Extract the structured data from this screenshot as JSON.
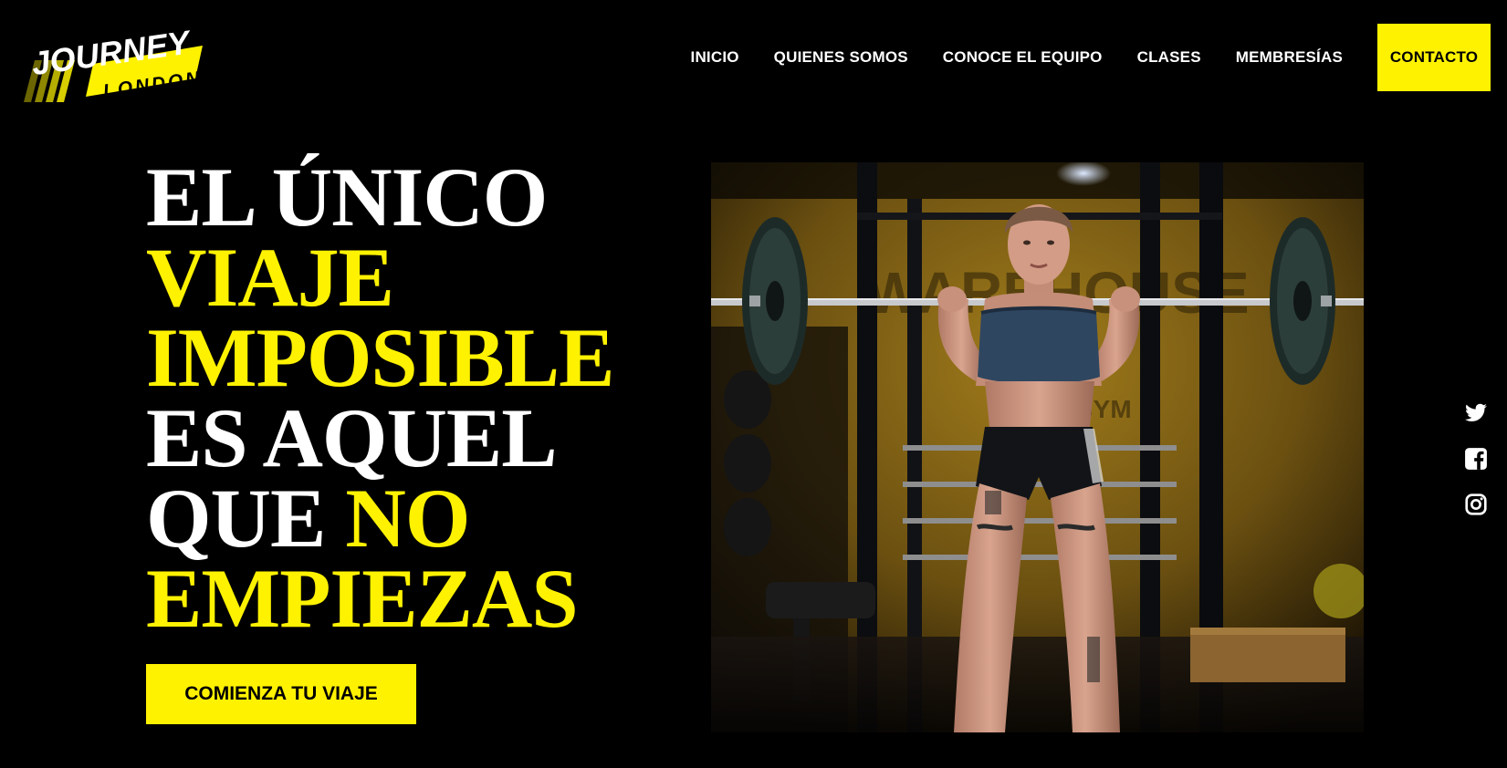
{
  "brand": {
    "logo_top": "JOURNEY",
    "logo_bottom": "LONDON",
    "accent_color": "#fff200",
    "background_color": "#000000"
  },
  "nav": {
    "items": [
      {
        "label": "INICIO"
      },
      {
        "label": "QUIENES SOMOS"
      },
      {
        "label": "CONOCE EL EQUIPO"
      },
      {
        "label": "CLASES"
      },
      {
        "label": "MEMBRESÍAS"
      }
    ],
    "contact_label": "CONTACTO"
  },
  "hero": {
    "line1": "EL ÚNICO",
    "line2": "VIAJE",
    "line3": "IMPOSIBLE",
    "line4": "ES AQUEL",
    "line5_white": "QUE",
    "line5_yellow": "NO",
    "line6": "EMPIEZAS",
    "cta_label": "COMIENZA TU VIAJE"
  },
  "photo": {
    "icon": "gym-woman-barbell-photo",
    "wall_text_1": "WAREHOUSE",
    "wall_text_2": "NOT GYM"
  },
  "social": {
    "icons": [
      "twitter-icon",
      "facebook-icon",
      "instagram-icon"
    ]
  }
}
